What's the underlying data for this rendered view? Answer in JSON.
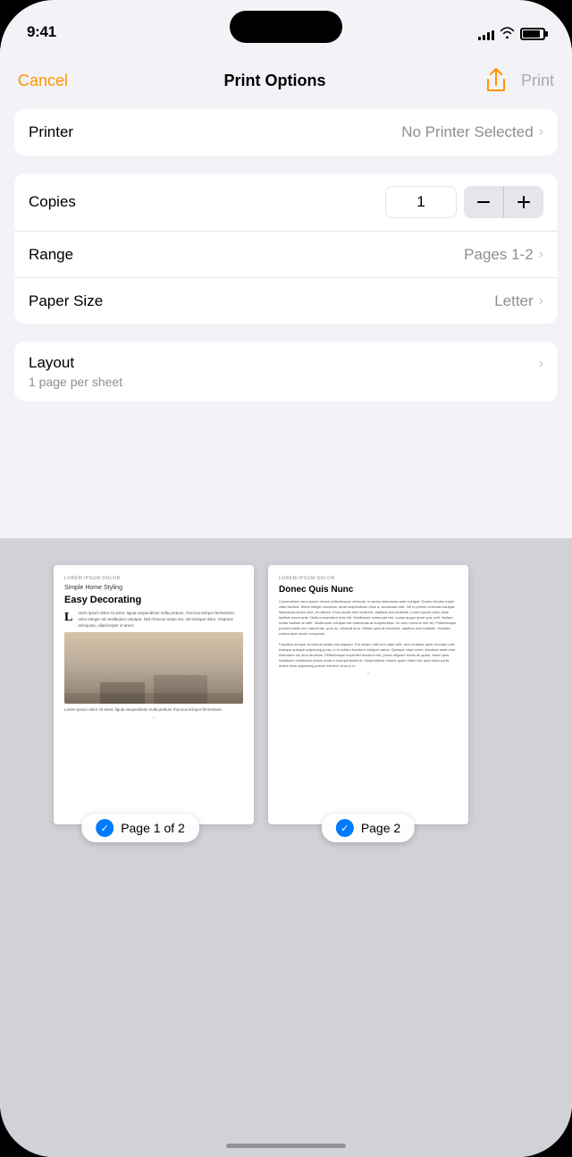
{
  "statusBar": {
    "time": "9:41",
    "signalBars": [
      4,
      6,
      9,
      11,
      14
    ],
    "batteryLevel": 85
  },
  "navBar": {
    "cancelLabel": "Cancel",
    "title": "Print Options",
    "printLabel": "Print"
  },
  "printer": {
    "label": "Printer",
    "value": "No Printer Selected"
  },
  "options": {
    "copies": {
      "label": "Copies",
      "value": "1"
    },
    "range": {
      "label": "Range",
      "value": "Pages 1-2"
    },
    "paperSize": {
      "label": "Paper Size",
      "value": "Letter"
    }
  },
  "layout": {
    "label": "Layout",
    "sublabel": "1 page per sheet"
  },
  "preview": {
    "page1": {
      "category": "Lorem Ipsum Dolor",
      "subtitle": "Simple Home Styling",
      "title": "Easy Decorating",
      "bodyText": "Lorem ipsum dolor sit amet, ligula suspendisse nulla pretium, rhoncus tempor fermentum, enim integer ad vestibulum volutpat. Nisl rhoncus turpis est, vel tristique dolor. Vitae enim. Vivamus enimjusto, ullamcorper ut amet.",
      "caption": "Lorem ipsum dolor sit amet, ligula suspendisse nulla pretium rhoncus tempor fermentum.",
      "pageNum": "1",
      "label": "Page 1 of 2"
    },
    "page2": {
      "category": "Lorem Ipsum Dolor",
      "title": "Donec Quis Nunc",
      "bodyText": "Consectetuer arcu ipsum ornare pellentesque vehicula, in varius maecenas ante volutpat. Donec lobortis turpis, montes nascetur lorem.",
      "pageNum": "2",
      "label": "Page 2"
    }
  }
}
